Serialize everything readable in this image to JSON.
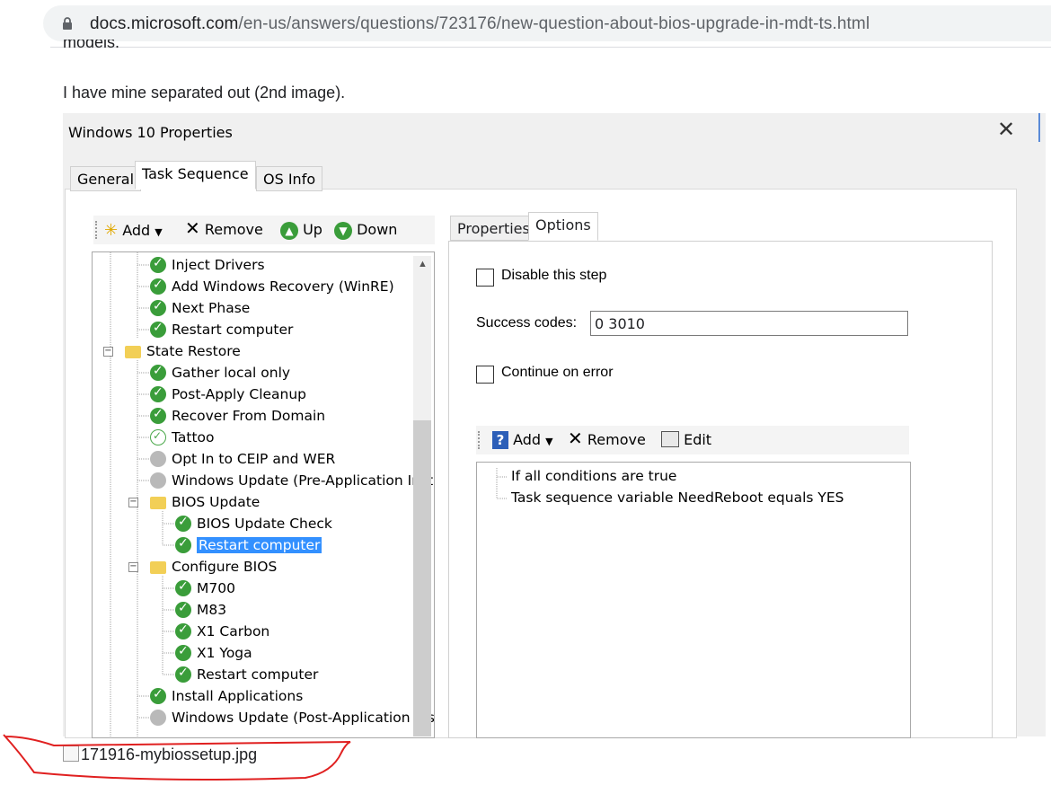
{
  "browser": {
    "url_host": "docs.microsoft.com",
    "url_path": "/en-us/answers/questions/723176/new-question-about-bios-upgrade-in-mdt-ts.html"
  },
  "post": {
    "clipped_text": "models.",
    "paragraph": "I have mine separated out (2nd image).",
    "broken_image_alt": "171916-mybiossetup.jpg"
  },
  "dialog": {
    "title": "Windows 10 Properties",
    "close_glyph": "✕",
    "tabs": [
      "General",
      "Task Sequence",
      "OS Info"
    ],
    "toolbar": {
      "add": "Add",
      "remove": "Remove",
      "up": "Up",
      "down": "Down"
    },
    "tree": [
      {
        "label": "Inject Drivers",
        "icon": "check-icon"
      },
      {
        "label": "Add Windows Recovery (WinRE)",
        "icon": "check-icon"
      },
      {
        "label": "Next Phase",
        "icon": "check-icon"
      },
      {
        "label": "Restart computer",
        "icon": "check-icon"
      },
      {
        "label": "State Restore",
        "icon": "folder-icon"
      },
      {
        "label": "Gather local only",
        "icon": "check-icon"
      },
      {
        "label": "Post-Apply Cleanup",
        "icon": "check-icon"
      },
      {
        "label": "Recover From Domain",
        "icon": "check-icon"
      },
      {
        "label": "Tattoo",
        "icon": "hollow-check-icon"
      },
      {
        "label": "Opt In to CEIP and WER",
        "icon": "disabled-icon"
      },
      {
        "label": "Windows Update (Pre-Application Inst",
        "icon": "disabled-icon"
      },
      {
        "label": "BIOS Update",
        "icon": "folder-icon"
      },
      {
        "label": "BIOS Update Check",
        "icon": "check-icon"
      },
      {
        "label": "Restart computer",
        "icon": "check-icon",
        "selected": true
      },
      {
        "label": "Configure BIOS",
        "icon": "folder-icon"
      },
      {
        "label": "M700",
        "icon": "check-icon"
      },
      {
        "label": "M83",
        "icon": "check-icon"
      },
      {
        "label": "X1 Carbon",
        "icon": "check-icon"
      },
      {
        "label": "X1 Yoga",
        "icon": "check-icon"
      },
      {
        "label": "Restart computer",
        "icon": "check-icon"
      },
      {
        "label": "Install Applications",
        "icon": "check-icon"
      },
      {
        "label": "Windows Update (Post-Application Ins",
        "icon": "disabled-icon"
      }
    ],
    "right_tabs": [
      "Properties",
      "Options"
    ],
    "options": {
      "disable_step": "Disable this step",
      "success_codes_label": "Success codes:",
      "success_codes_value": "0 3010",
      "continue_on_error": "Continue on error"
    },
    "cond_toolbar": {
      "add": "Add",
      "remove": "Remove",
      "edit": "Edit"
    },
    "conditions": [
      "If all conditions are true",
      "Task sequence variable NeedReboot equals YES"
    ]
  }
}
